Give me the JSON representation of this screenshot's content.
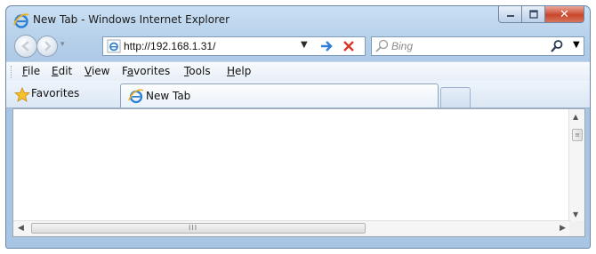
{
  "window": {
    "title": "New Tab - Windows Internet Explorer",
    "buttons": {
      "minimize_icon": "minimize-icon",
      "maximize_icon": "maximize-icon",
      "close_icon": "close-icon"
    },
    "close_color": "#c9462b"
  },
  "nav": {
    "back_icon": "back-arrow-icon",
    "forward_icon": "forward-arrow-icon",
    "address": {
      "value": "http://192.168.1.31/",
      "page_icon": "ie-page-icon"
    },
    "go_icon": "go-arrow-icon",
    "stop_icon": "stop-x-icon",
    "search": {
      "placeholder": "Bing",
      "icon": "search-icon"
    }
  },
  "menu": {
    "items": [
      {
        "label": "File",
        "accel": "F",
        "rest": "ile"
      },
      {
        "label": "Edit",
        "accel": "E",
        "rest": "dit"
      },
      {
        "label": "View",
        "accel": "V",
        "rest": "iew"
      },
      {
        "label": "Favorites",
        "pre": "F",
        "accel": "a",
        "rest": "vorites"
      },
      {
        "label": "Tools",
        "accel": "T",
        "rest": "ools"
      },
      {
        "label": "Help",
        "accel": "H",
        "rest": "elp"
      }
    ]
  },
  "favbar": {
    "favorites_label": "Favorites",
    "tab_label": "New Tab"
  },
  "colors": {
    "accent": "#3a78c9",
    "stop": "#d83a2a",
    "go": "#2f7fd6"
  }
}
